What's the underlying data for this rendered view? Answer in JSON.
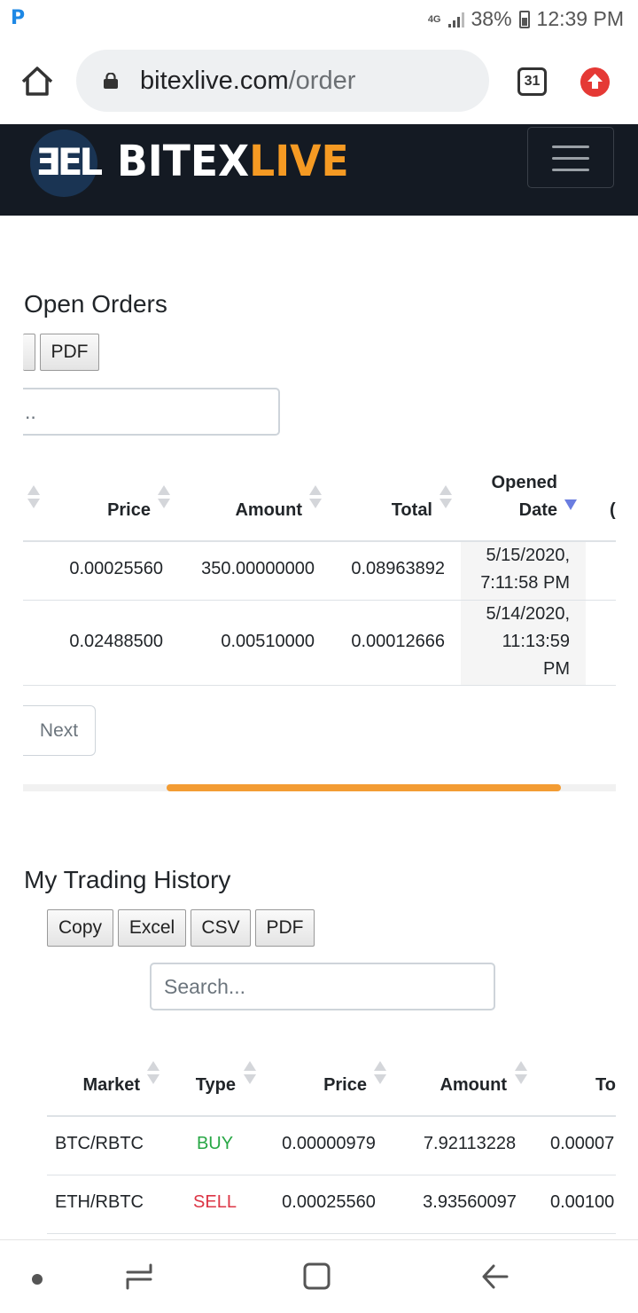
{
  "status_bar": {
    "app_icon": "P",
    "network": "4G",
    "battery": "38%",
    "time": "12:39 PM"
  },
  "browser": {
    "url_domain": "bitexlive.com",
    "url_path": "/order",
    "tab_count": "31"
  },
  "site": {
    "logo_mark": "ƎEL",
    "logo_word_a": "BITEX",
    "logo_word_b": "LIVE",
    "brand_colors": {
      "nav_bg": "#141a23",
      "accent": "#f59a23"
    }
  },
  "open_orders": {
    "title": "Open Orders",
    "buttons": [
      "",
      "PDF"
    ],
    "search_value": "..",
    "columns": [
      "Price",
      "Amount",
      "Total",
      "Opened",
      "Date"
    ],
    "rows": [
      {
        "price": "0.00025560",
        "amount": "350.00000000",
        "total": "0.08963892",
        "date": [
          "5/15/2020,",
          "7:11:58 PM"
        ]
      },
      {
        "price": "0.02488500",
        "amount": "0.00510000",
        "total": "0.00012666",
        "date": [
          "5/14/2020,",
          "11:13:59",
          "PM"
        ]
      }
    ],
    "next_label": "Next"
  },
  "trading_history": {
    "title": "My Trading History",
    "buttons": [
      "Copy",
      "Excel",
      "CSV",
      "PDF"
    ],
    "search_placeholder": "Search...",
    "columns": [
      "Market",
      "Type",
      "Price",
      "Amount",
      "To"
    ],
    "rows": [
      {
        "market": "BTC/RBTC",
        "type": "BUY",
        "price": "0.00000979",
        "amount": "7.92113228",
        "total": "0.00007"
      },
      {
        "market": "ETH/RBTC",
        "type": "SELL",
        "price": "0.00025560",
        "amount": "3.93560097",
        "total": "0.00100"
      }
    ],
    "type_colors": {
      "BUY": "#28a745",
      "SELL": "#dc3545"
    }
  }
}
